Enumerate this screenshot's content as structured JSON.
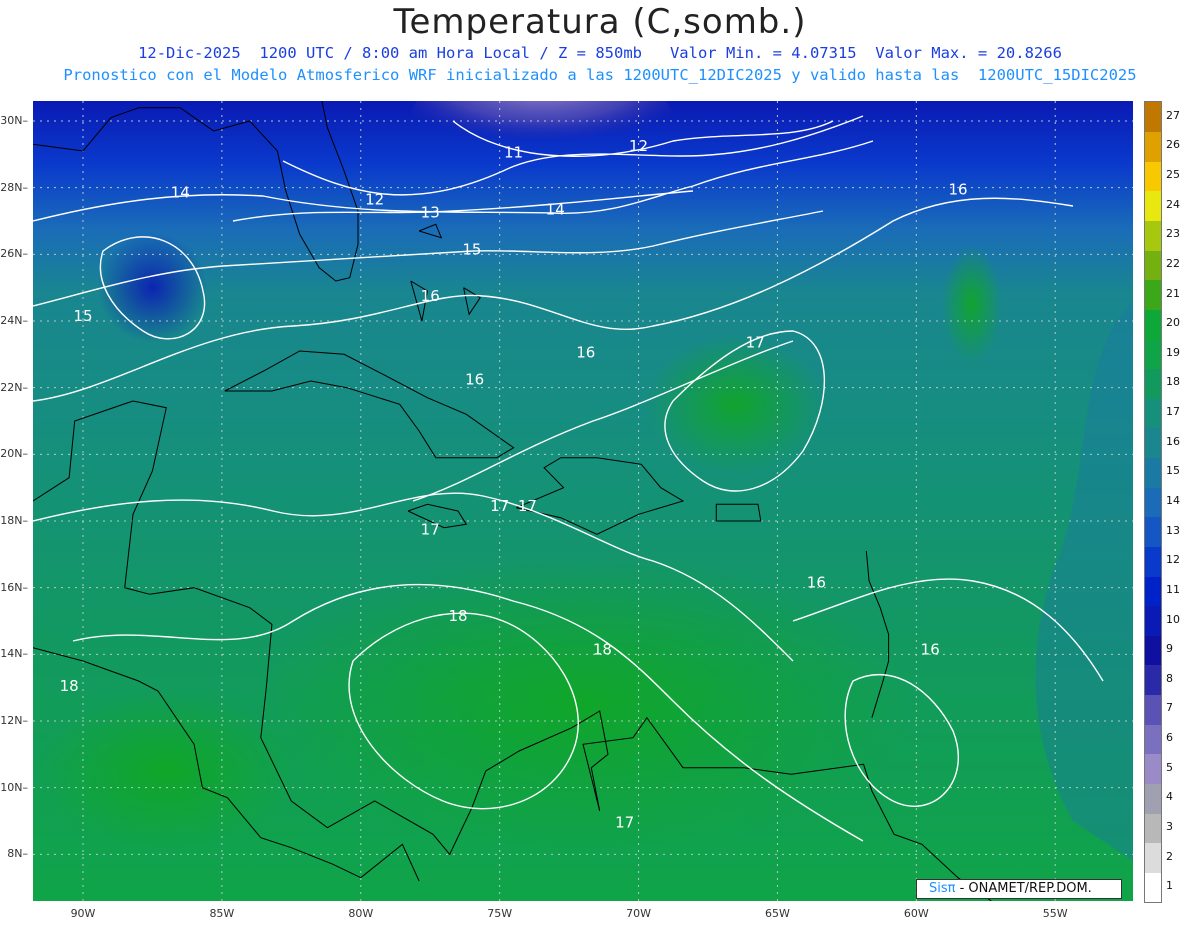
{
  "header": {
    "title": "Temperatura (C,somb.)",
    "line1": "12-Dic-2025  1200 UTC / 8:00 am Hora Local / Z = 850mb   Valor Min. = 4.07315  Valor Max. = 20.8266",
    "line2": "Pronostico con el Modelo Atmosferico WRF inicializado a las 1200UTC_12DIC2025 y valido hasta las  1200UTC_15DIC2025"
  },
  "credit": {
    "brand": "Sisπ",
    "text": " - ONAMET/REP.DOM."
  },
  "axes": {
    "lat_labels": [
      "30N",
      "28N",
      "26N",
      "24N",
      "22N",
      "20N",
      "18N",
      "16N",
      "14N",
      "12N",
      "10N",
      "8N"
    ],
    "lat_values": [
      30,
      28,
      26,
      24,
      22,
      20,
      18,
      16,
      14,
      12,
      10,
      8
    ],
    "lon_labels": [
      "90W",
      "85W",
      "80W",
      "75W",
      "70W",
      "65W",
      "60W",
      "55W"
    ],
    "lon_values": [
      -90,
      -85,
      -80,
      -75,
      -70,
      -65,
      -60,
      -55
    ],
    "lat_range": [
      6.6,
      30.6
    ],
    "lon_range": [
      -91.8,
      -52.2
    ]
  },
  "colorbar": {
    "levels": [
      "1",
      "2",
      "3",
      "4",
      "5",
      "6",
      "7",
      "8",
      "9",
      "10",
      "11",
      "12",
      "13",
      "14",
      "15",
      "16",
      "17",
      "18",
      "19",
      "20",
      "21",
      "22",
      "23",
      "24",
      "25",
      "26",
      "27"
    ],
    "colors": [
      "#ffffff",
      "#dcdcdc",
      "#b8b8b8",
      "#a0a0b0",
      "#9a8ac8",
      "#7b6fc0",
      "#5a52b4",
      "#2a2aa8",
      "#1010a0",
      "#0a1ab4",
      "#0022c8",
      "#0a3acc",
      "#1456c4",
      "#1a6cb8",
      "#1a7aa4",
      "#198690",
      "#15907a",
      "#129a5e",
      "#10a448",
      "#0ea838",
      "#3aa818",
      "#74b010",
      "#a8c810",
      "#e8e810",
      "#f8c800",
      "#e0a000",
      "#c07800"
    ]
  },
  "contour_labels": [
    {
      "text": "11",
      "lon": -74.5,
      "lat": 28.9
    },
    {
      "text": "12",
      "lon": -70.0,
      "lat": 29.1
    },
    {
      "text": "12",
      "lon": -79.5,
      "lat": 27.5
    },
    {
      "text": "13",
      "lon": -77.5,
      "lat": 27.1
    },
    {
      "text": "14",
      "lon": -73.0,
      "lat": 27.2
    },
    {
      "text": "14",
      "lon": -86.5,
      "lat": 27.7
    },
    {
      "text": "15",
      "lon": -76.0,
      "lat": 26.0
    },
    {
      "text": "15",
      "lon": -90.0,
      "lat": 24.0
    },
    {
      "text": "16",
      "lon": -77.5,
      "lat": 24.6
    },
    {
      "text": "16",
      "lon": -71.9,
      "lat": 22.9
    },
    {
      "text": "16",
      "lon": -75.9,
      "lat": 22.1
    },
    {
      "text": "16",
      "lon": -58.5,
      "lat": 27.8
    },
    {
      "text": "16",
      "lon": -63.6,
      "lat": 16.0
    },
    {
      "text": "16",
      "lon": -59.5,
      "lat": 14.0
    },
    {
      "text": "17",
      "lon": -65.8,
      "lat": 23.2
    },
    {
      "text": "17",
      "lon": -75.0,
      "lat": 18.3
    },
    {
      "text": "17",
      "lon": -74.0,
      "lat": 18.3
    },
    {
      "text": "17",
      "lon": -77.5,
      "lat": 17.6
    },
    {
      "text": "17",
      "lon": -70.5,
      "lat": 8.8
    },
    {
      "text": "18",
      "lon": -76.5,
      "lat": 15.0
    },
    {
      "text": "18",
      "lon": -71.3,
      "lat": 14.0
    },
    {
      "text": "18",
      "lon": -90.5,
      "lat": 12.9
    }
  ]
}
